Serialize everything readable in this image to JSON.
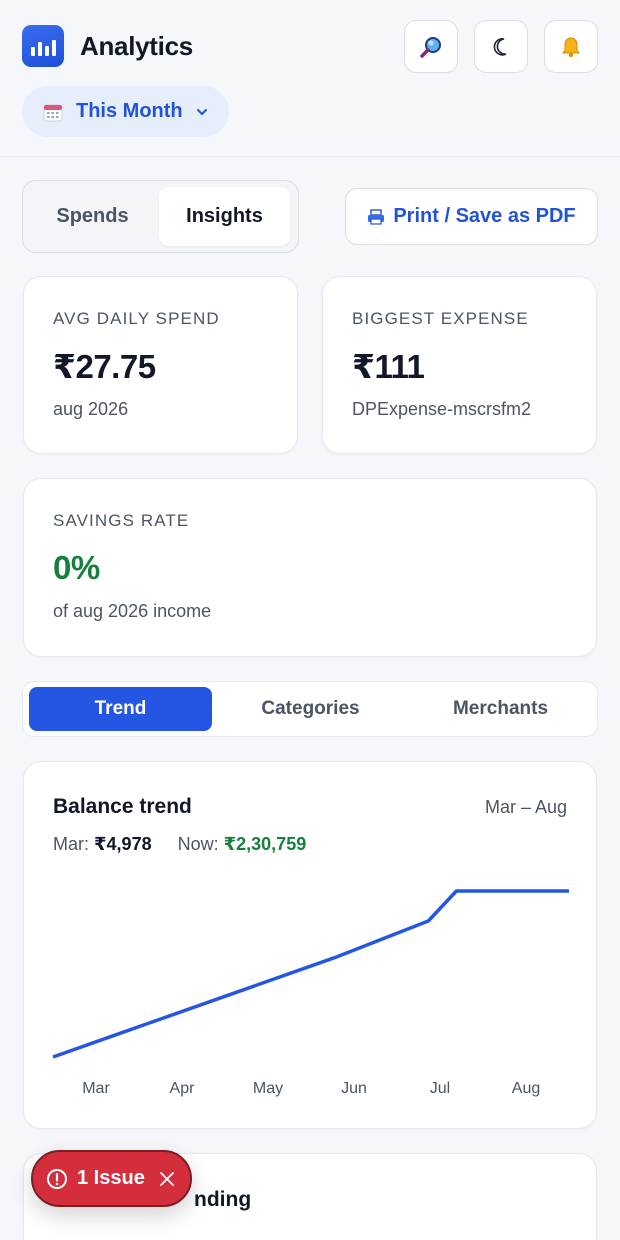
{
  "header": {
    "title": "Analytics",
    "month_label": "This Month",
    "icons": [
      "search-icon",
      "theme-moon-icon",
      "bell-icon"
    ]
  },
  "view_toggle": {
    "spends": "Spends",
    "insights": "Insights",
    "active": "Insights"
  },
  "print_button": "Print / Save as PDF",
  "stats": {
    "avg_daily": {
      "label": "AVG DAILY SPEND",
      "value": "₹27.75",
      "sub": "aug 2026"
    },
    "biggest": {
      "label": "BIGGEST EXPENSE",
      "value": "₹111",
      "sub": "DPExpense-mscrsfm2"
    },
    "savings": {
      "label": "SAVINGS RATE",
      "value": "0%",
      "sub": "of aug 2026 income"
    }
  },
  "colors": {
    "accent": "#2456e3",
    "positive": "#15803d",
    "danger": "#d42d3b"
  },
  "tabs": [
    {
      "label": "Trend"
    },
    {
      "label": "Categories"
    },
    {
      "label": "Merchants"
    }
  ],
  "trend_card": {
    "title": "Balance trend",
    "range": "Mar – Aug",
    "start_label": "Mar:",
    "start_value": "₹4,978",
    "now_label": "Now:",
    "now_value": "₹2,30,759"
  },
  "chart_data": {
    "type": "line",
    "categories": [
      "Mar",
      "Apr",
      "May",
      "Jun",
      "Jul",
      "Aug"
    ],
    "values": [
      4978,
      50000,
      95000,
      140000,
      190000,
      230759,
      230759
    ],
    "x": [
      0,
      1,
      2,
      3,
      4,
      4.3,
      5.5
    ],
    "title": "Balance trend",
    "xlabel": "",
    "ylabel": "",
    "grid": false,
    "color": "#2456e3"
  },
  "next_card": {
    "title_visible": "nding"
  },
  "issue_badge": {
    "label": "1 Issue"
  }
}
